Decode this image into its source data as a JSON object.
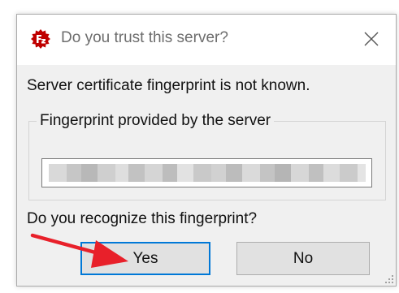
{
  "dialog": {
    "title": "Do you trust this server?",
    "app_icon": "filezilla-icon",
    "close_icon": "close-icon"
  },
  "message": "Server certificate fingerprint is not known.",
  "fingerprint_group": {
    "legend": "Fingerprint provided by the server",
    "value_state": "blurred"
  },
  "question": "Do you recognize this fingerprint?",
  "buttons": {
    "yes": "Yes",
    "no": "No"
  },
  "annotation": {
    "type": "arrow",
    "color": "#e8202a",
    "points_to": "yes-button"
  },
  "colors": {
    "dialog_bg": "#f0f0f0",
    "titlebar_bg": "#ffffff",
    "focus_border": "#0078d7",
    "filezilla_red": "#bf0000"
  }
}
